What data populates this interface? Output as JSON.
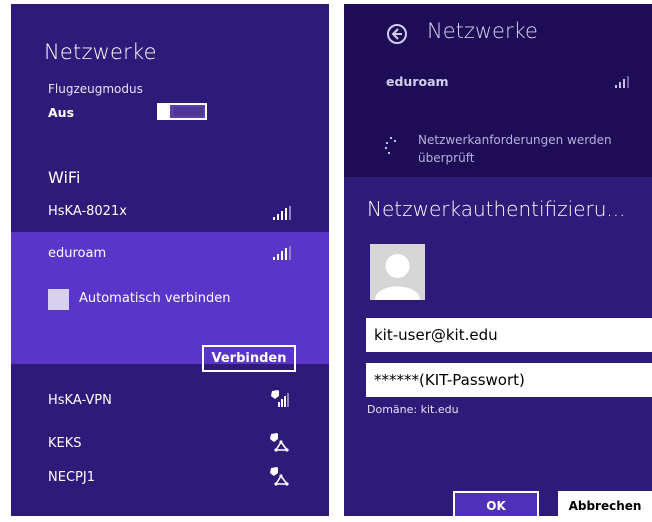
{
  "left_panel": {
    "title": "Netzwerke",
    "airplane_mode": {
      "label": "Flugzeugmodus",
      "value": "Aus"
    },
    "wifi_header": "WiFi",
    "networks": [
      {
        "name": "HsKA-8021x",
        "icon": "signal-icon"
      },
      {
        "name": "eduroam",
        "icon": "signal-icon"
      },
      {
        "name": "HsKA-VPN",
        "icon": "secured-signal-icon"
      },
      {
        "name": "KEKS",
        "icon": "secured-network-icon"
      },
      {
        "name": "NECPJ1",
        "icon": "secured-network-icon"
      }
    ],
    "auto_connect_label": "Automatisch verbinden",
    "connect_button": "Verbinden"
  },
  "right_panel": {
    "title": "Netzwerke",
    "network_name": "eduroam",
    "status_text_line1": "Netzwerkanforderungen werden",
    "status_text_line2": "überprüft",
    "auth_title": "Netzwerkauthentifizieru...",
    "username_value": "kit-user@kit.edu",
    "password_value": "******(KIT-Passwort)",
    "domain_text": "Domäne: kit.edu",
    "ok_button": "OK",
    "cancel_button": "Abbrechen"
  },
  "colors": {
    "panel_bg": "#2e1a79",
    "selected_bg": "#5935c8",
    "dark_bg": "#1f0c57"
  }
}
